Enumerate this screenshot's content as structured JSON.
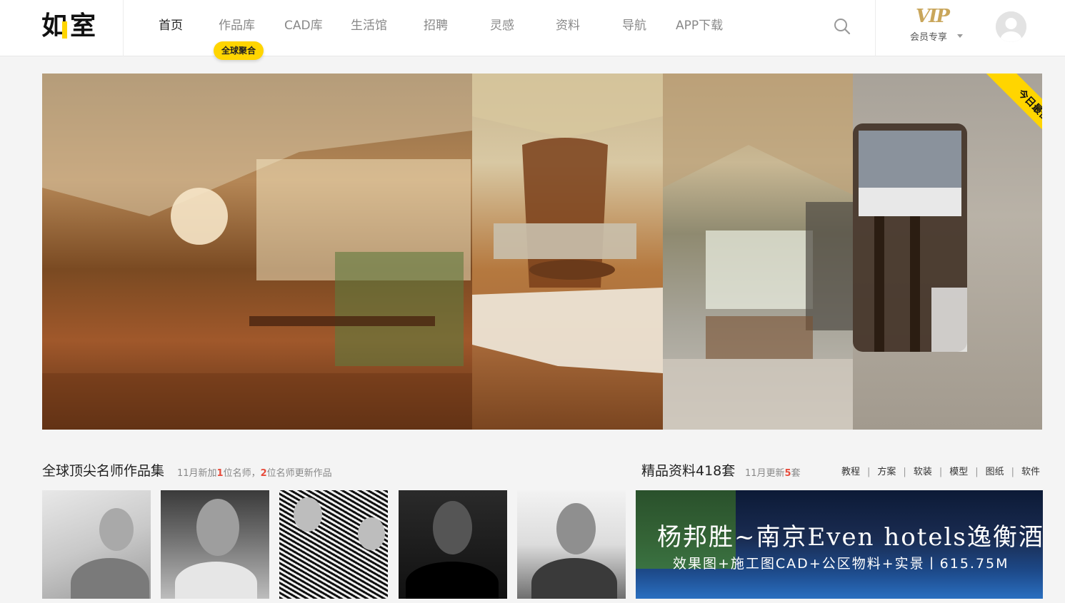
{
  "brand": {
    "logo_char_1": "如",
    "logo_char_2": "室"
  },
  "nav": {
    "items": [
      {
        "label": "首页"
      },
      {
        "label": "作品库"
      },
      {
        "label": "CAD库"
      },
      {
        "label": "生活馆"
      },
      {
        "label": "招聘"
      },
      {
        "label": "灵感"
      },
      {
        "label": "资料"
      },
      {
        "label": "导航"
      },
      {
        "label": "APP下载"
      }
    ],
    "active_index": 0,
    "badge": "全球聚合"
  },
  "header": {
    "vip_logo": "VIP",
    "vip_label": "会员专享",
    "icons": {
      "search": "search-icon",
      "avatar": "user-avatar",
      "dropdown": "caret-down-icon"
    }
  },
  "hero": {
    "ribbon": "今日最佳"
  },
  "designers": {
    "title": "全球顶尖名师作品集",
    "sub_pre": "11月新加",
    "sub_num1": "1",
    "sub_mid": "位名师，",
    "sub_num2": "2",
    "sub_post": "位名师更新作品"
  },
  "resources": {
    "title": "精品资料418套",
    "sub_pre": "11月更新",
    "sub_num": "5",
    "sub_post": "套",
    "categories": [
      "教程",
      "方案",
      "软装",
      "模型",
      "图纸",
      "软件"
    ],
    "separator": "|"
  },
  "banner": {
    "title": "杨邦胜~南京Even hotels逸衡酒店",
    "subtitle": "效果图+施工图CAD+公区物料+实景丨615.75M"
  },
  "colors": {
    "accent": "#ffd500",
    "highlight": "#e74c3c",
    "vip_gold": "#c9a65b"
  }
}
